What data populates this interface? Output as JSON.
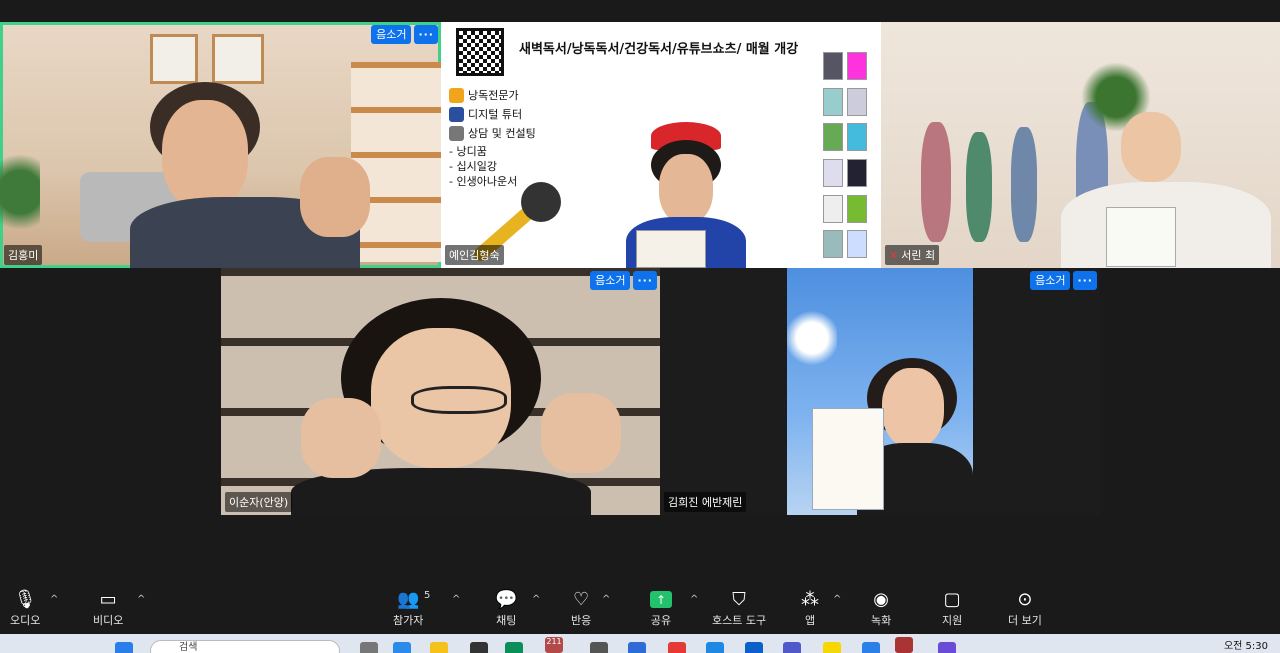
{
  "participants": [
    {
      "name": "김홍미",
      "mute_label": "음소거",
      "active": true
    },
    {
      "name": "예인김형숙"
    },
    {
      "name": "서린 최",
      "muted": true
    },
    {
      "name": "이순자(안양)",
      "mute_label": "음소거"
    },
    {
      "name": "김희진 에반제린",
      "mute_label": "음소거"
    }
  ],
  "more_label": "···",
  "slide": {
    "title": "새벽독서/낭독독서/건강독서/유튜브쇼츠/ 매월 개강",
    "items": [
      "낭독전문가",
      "디지털 튜터",
      "상담 및 컨설팅"
    ],
    "subitems": [
      "- 낭디꿈",
      "- 십시일강",
      "- 인생아나운서"
    ]
  },
  "toolbar": {
    "audio": "오디오",
    "video": "비디오",
    "participants": "참가자",
    "participants_count": "5",
    "chat": "채팅",
    "reactions": "반응",
    "share": "공유",
    "host_tools": "호스트 도구",
    "apps": "앱",
    "record": "녹화",
    "support": "지원",
    "more": "더 보기"
  },
  "taskbar": {
    "search_placeholder": "검색",
    "clock": "오전 5:30",
    "badge": "211"
  },
  "colors": {
    "accent": "#0e72ed",
    "active_border": "#3fd18a",
    "share": "#23c16b"
  }
}
